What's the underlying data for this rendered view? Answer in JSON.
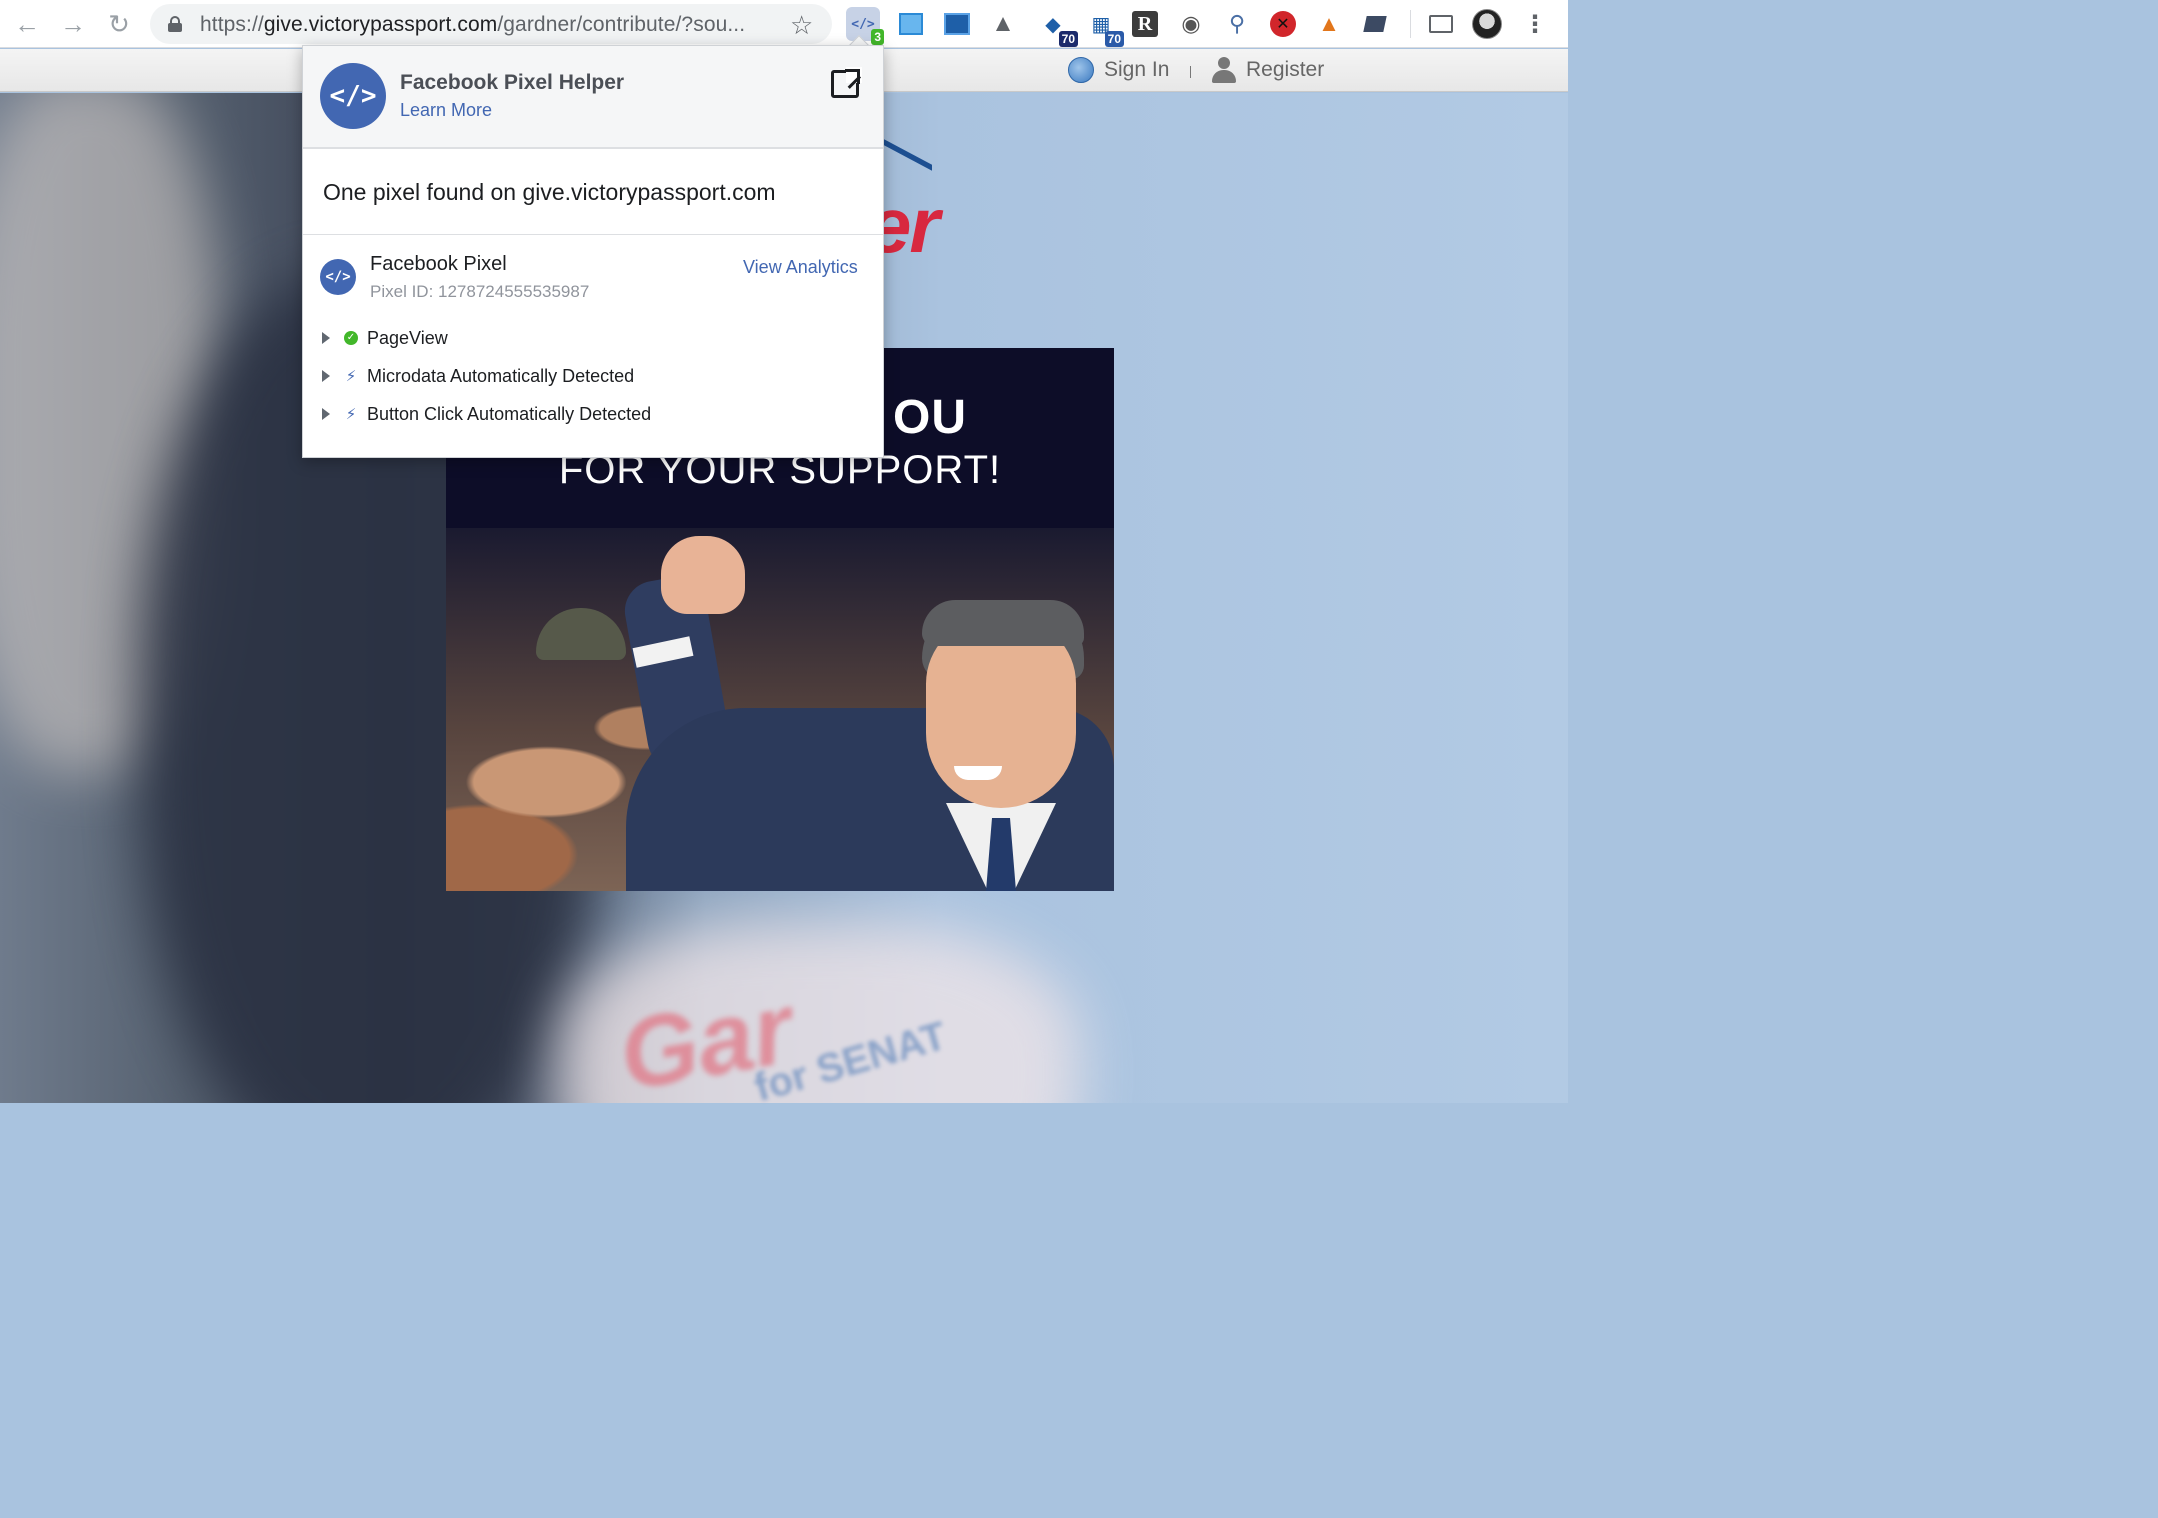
{
  "browser": {
    "url_prefix": "https://",
    "url_host": "give.victorypassport.com",
    "url_path": "/gardner/contribute/?sou...",
    "extensions": [
      {
        "name": "facebook-pixel-helper-icon",
        "badge": "3"
      },
      {
        "name": "extension-window-icon"
      },
      {
        "name": "extension-screenshot-icon"
      },
      {
        "name": "google-drive-icon"
      },
      {
        "name": "extension-70-a-icon",
        "badge": "70"
      },
      {
        "name": "extension-70-b-icon",
        "badge": "70"
      },
      {
        "name": "extension-r-icon"
      },
      {
        "name": "extension-eye-icon"
      },
      {
        "name": "extension-search-icon"
      },
      {
        "name": "extension-block-icon"
      },
      {
        "name": "metamask-fox-icon"
      },
      {
        "name": "extension-folder-icon"
      },
      {
        "name": "cast-icon"
      },
      {
        "name": "profile-avatar"
      },
      {
        "name": "menu-dots-icon"
      }
    ]
  },
  "site": {
    "sign_in": "Sign In",
    "register": "Register",
    "logo_fragment": "er",
    "hero_line1": "OU",
    "hero_line2": "FOR YOUR SUPPORT!",
    "sign_text_main": "Gar",
    "sign_text_sub": "for SENAT"
  },
  "popup": {
    "title": "Facebook Pixel Helper",
    "learn_more": "Learn More",
    "summary": "One pixel found on give.victorypassport.com",
    "pixel": {
      "name": "Facebook Pixel",
      "id_label": "Pixel ID: 1278724555535987",
      "view_analytics": "View Analytics"
    },
    "events": [
      {
        "label": "PageView",
        "status": "success"
      },
      {
        "label": "Microdata Automatically Detected",
        "status": "auto"
      },
      {
        "label": "Button Click Automatically Detected",
        "status": "auto"
      }
    ]
  },
  "colors": {
    "facebook_blue": "#4267b2",
    "success_green": "#42b72a",
    "brand_red": "#d8283f"
  }
}
